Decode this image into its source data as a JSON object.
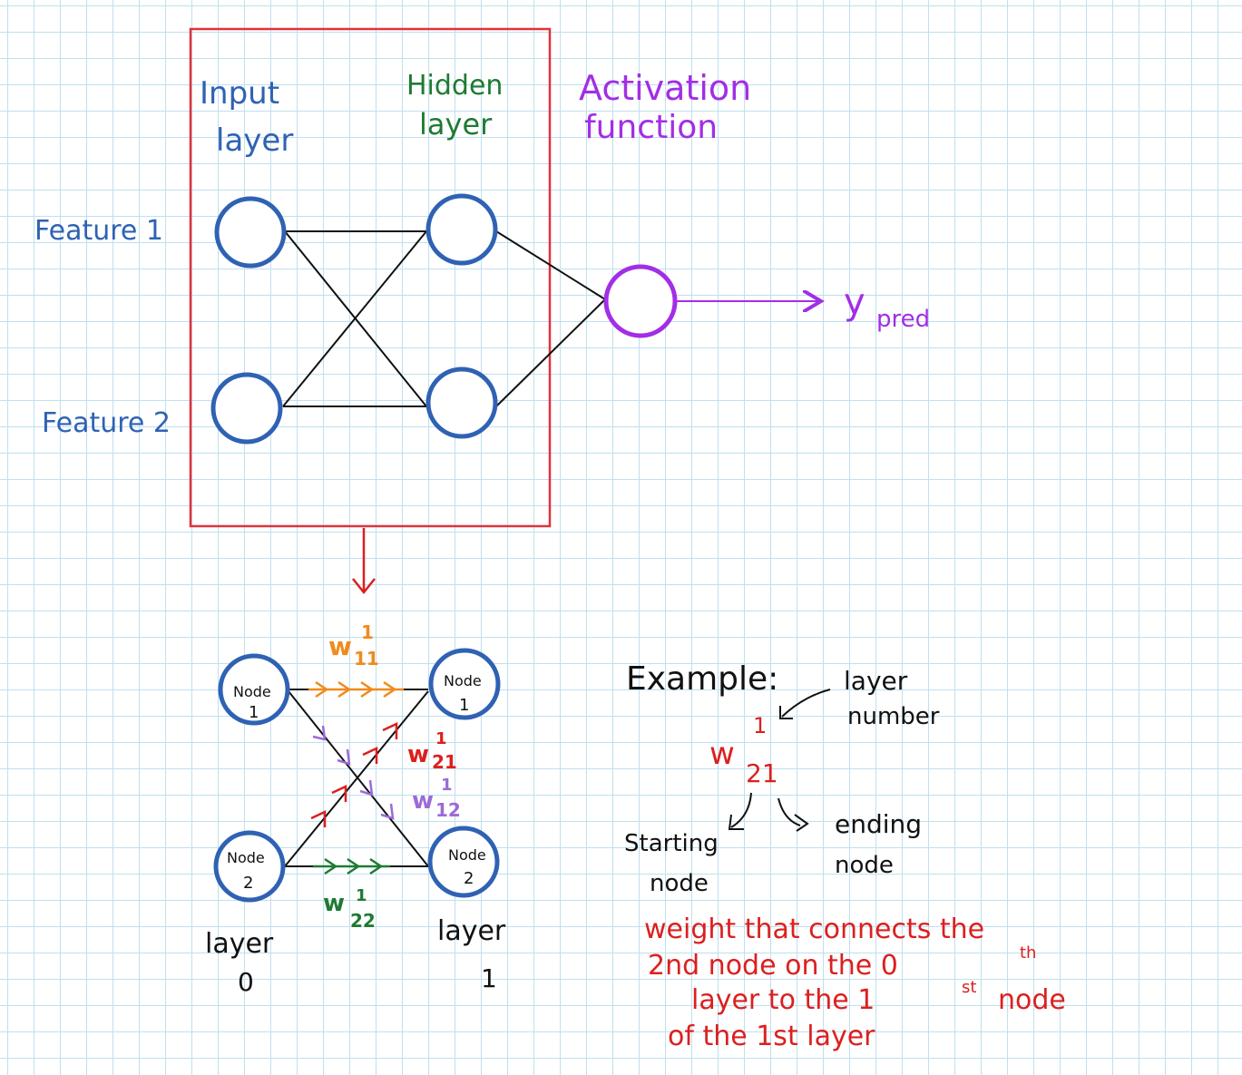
{
  "colors": {
    "blue": "#2f62b3",
    "green": "#1f7a33",
    "purple": "#a22ee6",
    "red": "#dc1f1f",
    "orange": "#f08a1c",
    "violet": "#9b6bd6",
    "ink": "#111111",
    "box": "#e0323b"
  },
  "top": {
    "input_layer": [
      "Input",
      "layer"
    ],
    "hidden_layer": [
      "Hidden",
      "layer"
    ],
    "activation": [
      "Activation",
      "function"
    ],
    "feature1": "Feature 1",
    "feature2": "Feature 2",
    "output_y": "y",
    "output_sub": "pred"
  },
  "detail": {
    "node_word": "Node",
    "in1": "1",
    "in2": "2",
    "out1": "1",
    "out2": "2",
    "w_letter": "w",
    "w11_sup": "1",
    "w11_sub": "11",
    "w21_sup": "1",
    "w21_sub": "21",
    "w12_sup": "1",
    "w12_sub": "12",
    "w22_sup": "1",
    "w22_sub": "22",
    "layer0": [
      "layer",
      "0"
    ],
    "layer1": [
      "layer",
      "1"
    ]
  },
  "example": {
    "title": "Example:",
    "layer_number": [
      "layer",
      "number"
    ],
    "w": "w",
    "sup": "1",
    "sub": "21",
    "starting": [
      "Starting",
      "node"
    ],
    "ending": [
      "ending",
      "node"
    ],
    "explanation": [
      "weight that connects the",
      "2nd node on the 0",
      "layer to the 1",
      "of the 1st layer"
    ],
    "sup_th": "th",
    "sup_st": "st",
    "node_word": "node"
  }
}
